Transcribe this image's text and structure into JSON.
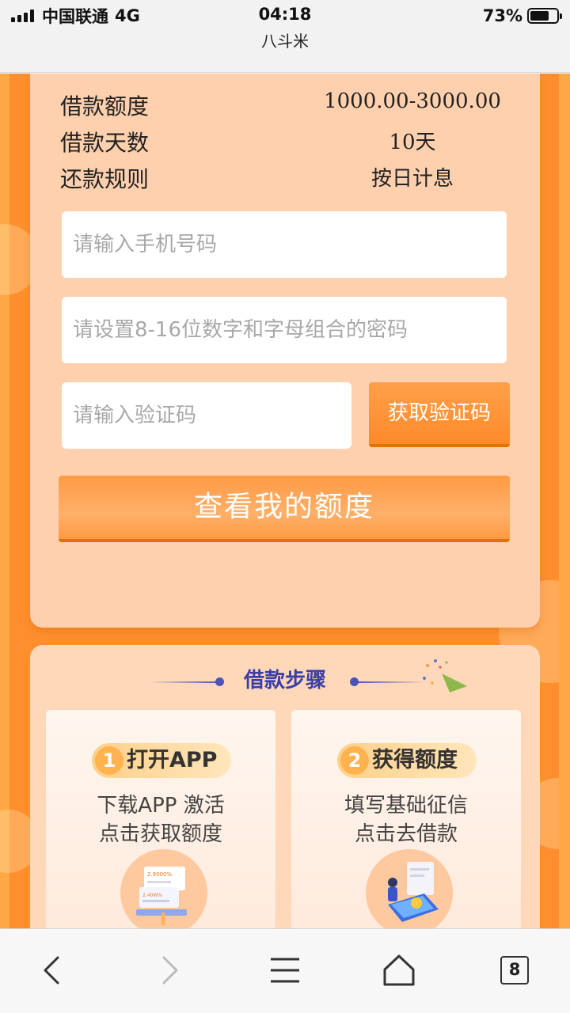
{
  "status_bar": {
    "carrier": "中国联通",
    "network": "4G",
    "time": "04:18",
    "site_title": "八斗米",
    "battery": "73%",
    "battery_level": 0.73
  },
  "loan_info": [
    {
      "label": "借款额度",
      "value": "1000.00-3000.00"
    },
    {
      "label": "借款天数",
      "value": "10天"
    },
    {
      "label": "还款规则",
      "value": "按日计息"
    }
  ],
  "form": {
    "phone_placeholder": "请输入手机号码",
    "password_placeholder": "请设置8-16位数字和字母组合的密码",
    "code_placeholder": "请输入验证码",
    "get_code_label": "获取验证码",
    "submit_label": "查看我的额度"
  },
  "steps": {
    "title": "借款步骤",
    "items": [
      {
        "num": "1",
        "name": "打开APP",
        "line1": "下载APP 激活",
        "line2": "点击获取额度"
      },
      {
        "num": "2",
        "name": "获得额度",
        "line1": "填写基础征信",
        "line2": "点击去借款"
      }
    ]
  },
  "illustration_text": {
    "amount_1": "2.9000%",
    "amount_2": "2.40W%"
  },
  "browser_bar": {
    "tabs_count": "8"
  },
  "colors": {
    "page_orange": "#ff8f2e",
    "card_peach": "#ffd0ad",
    "button_orange": "#ff9a44",
    "steps_title_blue": "#3a3fa8"
  },
  "icons": [
    "signal-icon",
    "battery-icon",
    "back-icon",
    "forward-icon",
    "menu-icon",
    "home-icon",
    "tabs-icon",
    "confetti-icon"
  ]
}
